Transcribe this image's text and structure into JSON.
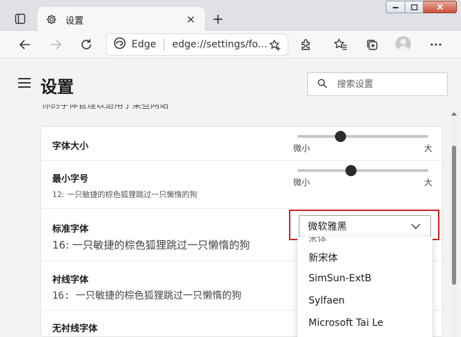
{
  "browser": {
    "tab": {
      "title": "设置"
    },
    "new_tab_symbol": "+",
    "address": {
      "site_label": "Edge",
      "url": "edge://settings/fo..."
    }
  },
  "settings": {
    "page_title": "设置",
    "search": {
      "placeholder": "搜索设置"
    },
    "clipped_description": "你的字体管理以适用于某些网站",
    "font_size": {
      "label": "字体大小",
      "min_label": "微小",
      "max_label": "大",
      "level": 0.33
    },
    "min_font_size": {
      "label": "最小字号",
      "sample": "12: 一只敏捷的棕色狐狸跳过一只懒惰的狗",
      "min_label": "微小",
      "max_label": "大",
      "level": 0.41
    },
    "standard_font": {
      "label": "标准字体",
      "sample": "16: 一只敏捷的棕色狐狸跳过一只懒惰的狗",
      "selected": "微软雅黑"
    },
    "serif_font": {
      "label": "衬线字体",
      "sample": "16: 一只敏捷的棕色狐狸跳过一只懒惰的狗"
    },
    "sans_serif_font": {
      "label": "无衬线字体"
    },
    "dropdown_options": {
      "clipped": "宋体",
      "items": [
        "新宋体",
        "SimSun-ExtB",
        "Sylfaen",
        "Microsoft Tai Le"
      ]
    }
  },
  "colors": {
    "highlight": "#d51c1c",
    "window_close": "#c8513a"
  }
}
